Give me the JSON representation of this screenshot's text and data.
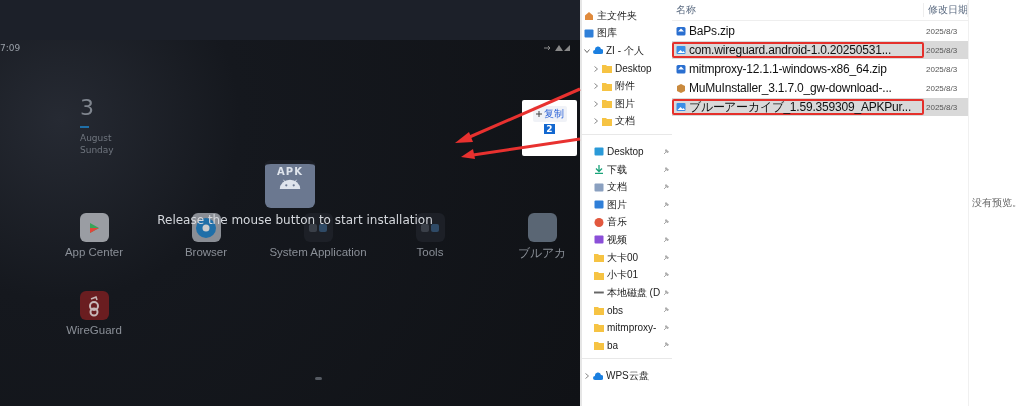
{
  "emulator": {
    "clock": "7:09",
    "date": {
      "day": "3",
      "month": "August",
      "weekday": "Sunday"
    },
    "apps": [
      {
        "label": "App Center",
        "kind": "store"
      },
      {
        "label": "Browser",
        "kind": "browser"
      },
      {
        "label": "System Application",
        "kind": "folder"
      },
      {
        "label": "Tools",
        "kind": "folder"
      },
      {
        "label": "ブルアカ",
        "kind": "game"
      },
      {
        "label": "WireGuard",
        "kind": "wireguard"
      }
    ],
    "drag": {
      "badge": "APK",
      "message": "Release the mouse button to start installation"
    },
    "drop_tip": {
      "action": "复制",
      "count": "2"
    }
  },
  "explorer": {
    "nav": [
      {
        "items": [
          {
            "label": "主文件夹",
            "kind": "home"
          },
          {
            "label": "图库",
            "kind": "gallery"
          },
          {
            "label": "ZI - 个人",
            "kind": "cloud",
            "expanded": true,
            "children": [
              {
                "label": "Desktop",
                "kind": "folder",
                "expanded": false
              },
              {
                "label": "附件",
                "kind": "folder",
                "expanded": false
              },
              {
                "label": "图片",
                "kind": "folder",
                "expanded": false
              },
              {
                "label": "文档",
                "kind": "folder",
                "expanded": false
              }
            ]
          }
        ]
      },
      {
        "items": [
          {
            "label": "Desktop",
            "kind": "desktop",
            "pinned": true
          },
          {
            "label": "下载",
            "kind": "download",
            "pinned": true
          },
          {
            "label": "文档",
            "kind": "document",
            "pinned": true
          },
          {
            "label": "图片",
            "kind": "picture",
            "pinned": true
          },
          {
            "label": "音乐",
            "kind": "music",
            "pinned": true
          },
          {
            "label": "视频",
            "kind": "video",
            "pinned": true
          },
          {
            "label": "大卡00",
            "kind": "folder",
            "pinned": true
          },
          {
            "label": "小卡01",
            "kind": "folder",
            "pinned": true
          },
          {
            "label": "本地磁盘 (D",
            "kind": "drive",
            "pinned": true
          },
          {
            "label": "obs",
            "kind": "folder",
            "pinned": true
          },
          {
            "label": "mitmproxy-",
            "kind": "folder",
            "pinned": true
          },
          {
            "label": "ba",
            "kind": "folder",
            "pinned": true
          }
        ]
      },
      {
        "items": [
          {
            "label": "WPS云盘",
            "kind": "cloud",
            "expanded": false
          }
        ]
      }
    ],
    "columns": [
      "名称",
      "修改日期"
    ],
    "files": [
      {
        "name": "BaPs.zip",
        "date": "2025/8/3",
        "kind": "archive",
        "selected": false,
        "annotated": false
      },
      {
        "name": "com.wireguard.android-1.0.20250531...",
        "date": "2025/8/3",
        "kind": "image",
        "selected": true,
        "annotated": true
      },
      {
        "name": "mitmproxy-12.1.1-windows-x86_64.zip",
        "date": "2025/8/3",
        "kind": "archive",
        "selected": false,
        "annotated": false
      },
      {
        "name": "MuMuInstaller_3.1.7.0_gw-download-...",
        "date": "2025/8/3",
        "kind": "package",
        "selected": false,
        "annotated": false
      },
      {
        "name": "ブルーアーカイブ_1.59.359309_APKPur...",
        "date": "2025/8/3",
        "kind": "image",
        "selected": true,
        "annotated": true
      }
    ],
    "preview": "没有预览。"
  }
}
